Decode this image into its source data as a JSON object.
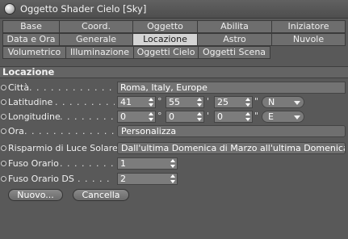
{
  "window": {
    "title": "Oggetto Shader Cielo [Sky]"
  },
  "tabs": {
    "row1": [
      "Base",
      "Coord.",
      "Oggetto",
      "Abilita",
      "Iniziatore"
    ],
    "row2": [
      "Data e Ora",
      "Generale",
      "Locazione",
      "Astro",
      "Nuvole"
    ],
    "row3": [
      "Volumetrico",
      "Illuminazione",
      "Oggetti Cielo",
      "Oggetti Scena"
    ],
    "active": "Locazione"
  },
  "section": {
    "title": "Locazione"
  },
  "fields": {
    "citta": {
      "label": "Città",
      "dots": ". . . . . . . . . . . . . . . . .",
      "value": "Roma, Italy, Europe"
    },
    "latitudine": {
      "label": "Latitudine",
      "dots": ". . . . . . . . . . . .",
      "degrees": "41",
      "minutes": "55",
      "seconds": "25",
      "hemisphere": "N",
      "deg_sym": "°",
      "min_sym": "'",
      "sec_sym": "\""
    },
    "longitudine": {
      "label": "Longitudine",
      "dots": ". . . . . . . . . . .",
      "degrees": "0",
      "minutes": "0",
      "seconds": "0",
      "hemisphere": "E",
      "deg_sym": "°",
      "min_sym": "'",
      "sec_sym": "\""
    },
    "ora": {
      "label": "Ora",
      "dots": ". . . . . . . . . . . . . . . . . .",
      "value": "Personalizza"
    },
    "risparmio": {
      "label": "Risparmio di Luce Solare",
      "value": "Dall'ultima Domenica di Marzo all'ultima Domenica"
    },
    "fuso_orario": {
      "label": "Fuso Orario",
      "dots": ". . . . . . . . . . .",
      "value": "1"
    },
    "fuso_orario_ds": {
      "label": "Fuso Orario DS",
      "dots": ". . . . . . . .",
      "value": "2"
    }
  },
  "buttons": {
    "new": "Nuovo...",
    "cancel": "Cancella"
  }
}
